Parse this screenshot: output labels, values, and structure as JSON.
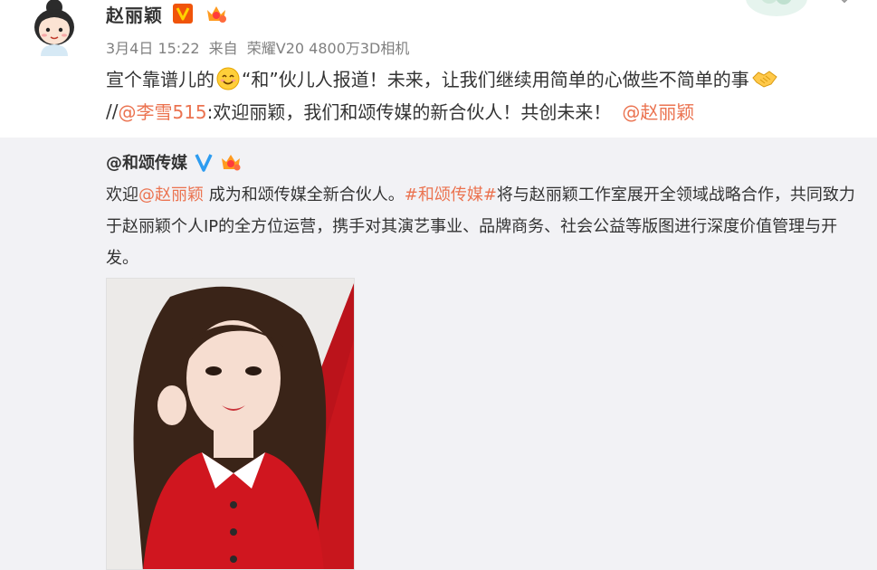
{
  "post": {
    "author_name": "赵丽颖",
    "verified_icon": "v-badge-icon",
    "vip_icon": "vip-crown-icon",
    "timestamp": "3月4日 15:22",
    "source_prefix": "来自",
    "source_device": "荣耀V20 4800万3D相机",
    "line1_part1": "宣个靠谱儿的",
    "line1_part2": "“和”伙儿人报道！未来，让我们继续用简单的心做些不简单的事",
    "line2_prefix": "//",
    "line2_mention": "@李雪515",
    "line2_text": ":欢迎丽颖，我们和颂传媒的新合伙人！共创未来！",
    "line2_mention2": "@赵丽颖"
  },
  "repost": {
    "author_name": "@和颂传媒",
    "verified_icon": "blue-v-icon",
    "vip_icon": "vip-crown-icon",
    "text_part1": "欢迎",
    "text_mention": "@赵丽颖",
    "text_part2": " 成为和颂传媒全新合伙人。",
    "text_hashtag": "#和颂传媒#",
    "text_part3": "将与赵丽颖工作室展开全领域战略合作，共同致力于赵丽颖个人IP的全方位运营，携手对其演艺事业、品牌商务、社会公益等版图进行深度价值管理与开发。"
  },
  "colors": {
    "link": "#eb7350",
    "repost_bg": "#f2f2f5",
    "meta": "#808080",
    "photo_red": "#c8161d"
  }
}
